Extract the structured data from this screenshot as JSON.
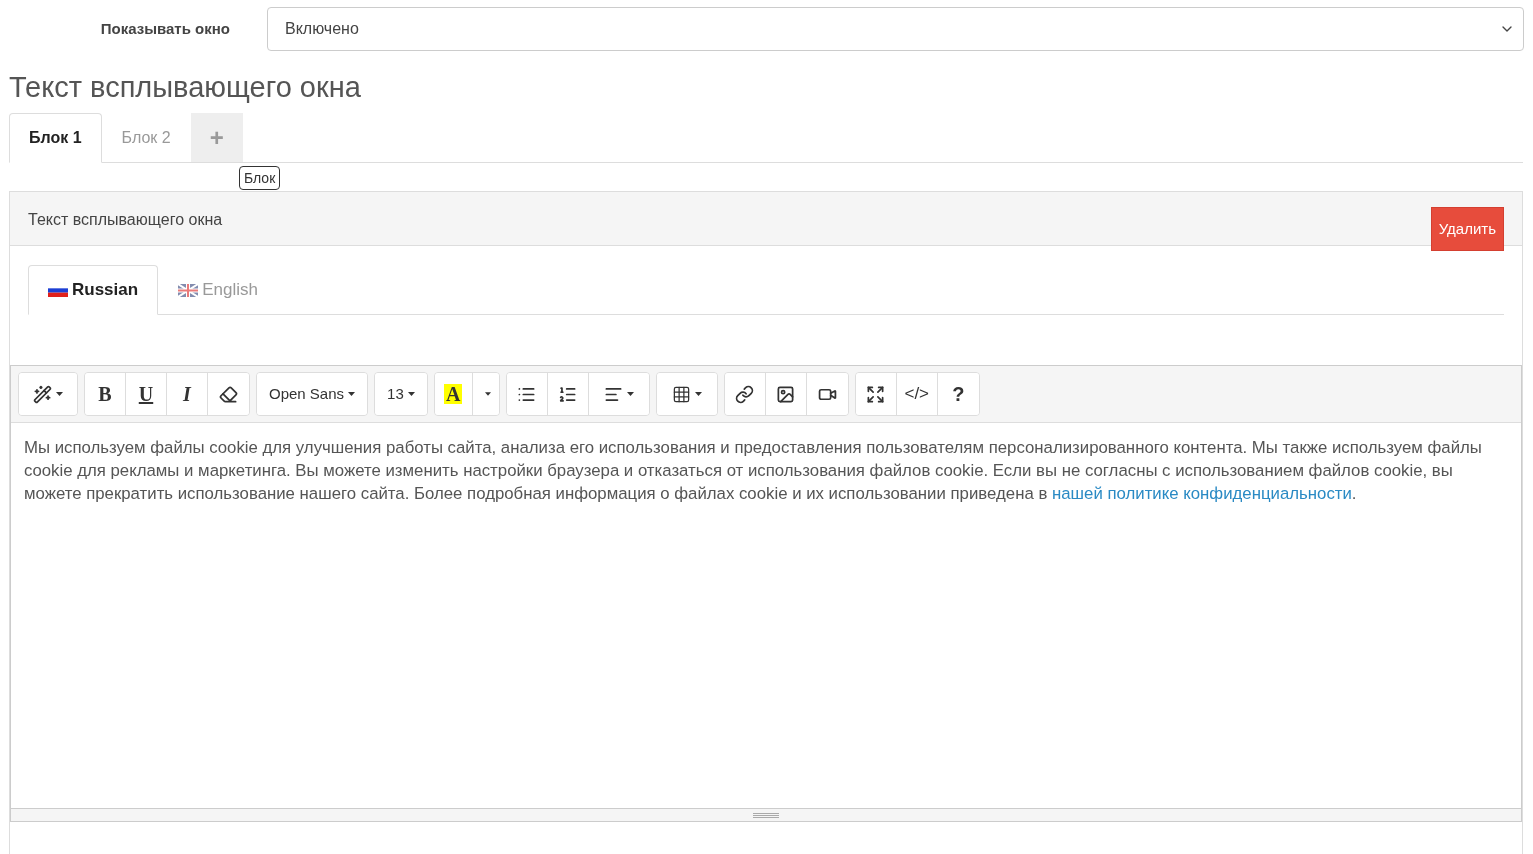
{
  "setting": {
    "label": "Показывать окно",
    "value": "Включено"
  },
  "heading": "Текст всплывающего окна",
  "block_tabs": [
    {
      "label": "Блок 1",
      "selected": true
    },
    {
      "label": "Блок 2",
      "selected": false
    }
  ],
  "add_tab": {
    "label": "+"
  },
  "tooltip": "Блок",
  "panel": {
    "title": "Текст всплывающего окна",
    "delete_button": "Удалить"
  },
  "language_tabs": [
    {
      "label": "Russian",
      "kind": "ru",
      "selected": true
    },
    {
      "label": "English",
      "kind": "gb",
      "selected": false
    }
  ],
  "toolbar": [
    {
      "buttons": [
        {
          "kind": "magic"
        }
      ]
    },
    {
      "buttons": [
        {
          "kind": "bold",
          "label": "B"
        },
        {
          "kind": "underline",
          "label": "U"
        },
        {
          "kind": "italic",
          "label": "I"
        },
        {
          "kind": "eraser"
        }
      ]
    },
    {
      "buttons": [
        {
          "kind": "dropdown",
          "label": "Open Sans"
        }
      ]
    },
    {
      "buttons": [
        {
          "kind": "dropdown",
          "label": "13"
        }
      ]
    },
    {
      "buttons": [
        {
          "kind": "highlight",
          "label": "A"
        },
        {
          "kind": "caret"
        }
      ]
    },
    {
      "buttons": [
        {
          "kind": "list"
        },
        {
          "kind": "ordered-list"
        },
        {
          "kind": "align"
        }
      ]
    },
    {
      "buttons": [
        {
          "kind": "table"
        }
      ]
    },
    {
      "buttons": [
        {
          "kind": "link"
        },
        {
          "kind": "image"
        },
        {
          "kind": "video"
        }
      ]
    },
    {
      "buttons": [
        {
          "kind": "fullscreen"
        },
        {
          "kind": "text",
          "label": "</>"
        },
        {
          "kind": "help",
          "label": "?"
        }
      ]
    }
  ],
  "content": {
    "text": "Мы используем файлы cookie для улучшения работы сайта, анализа его использования и предоставления пользователям персонализированного контента. Мы также используем файлы cookie для рекламы и маркетинга. Вы можете изменить настройки браузера и отказаться от использования файлов cookie. Если вы не согласны с использованием файлов cookie, вы можете прекратить использование нашего сайта. Более подробная информация о файлах cookie и их использовании приведена в ",
    "link": "нашей политике конфиденциальности",
    "end": "."
  }
}
